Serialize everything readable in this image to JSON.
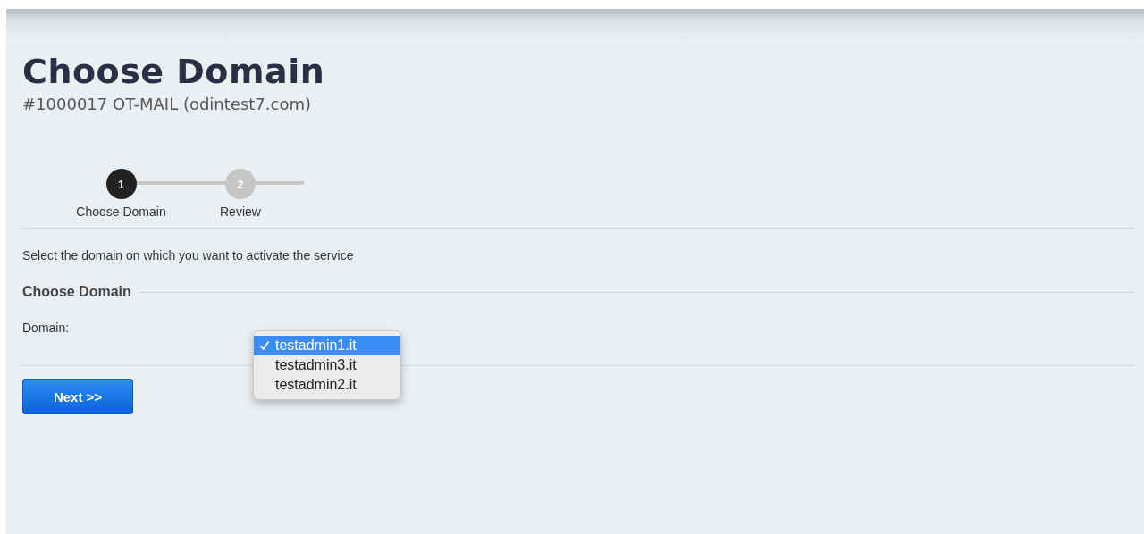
{
  "page": {
    "title": "Choose Domain",
    "subtitle": "#1000017 OT-MAIL (odintest7.com)"
  },
  "steps": [
    {
      "number": "1",
      "label": "Choose Domain",
      "current": true
    },
    {
      "number": "2",
      "label": "Review",
      "current": false
    }
  ],
  "instruction": "Select the domain on which you want to activate the service",
  "section": {
    "title": "Choose Domain"
  },
  "domain_field": {
    "label": "Domain:",
    "options": [
      {
        "label": "testadmin1.it",
        "selected": true
      },
      {
        "label": "testadmin3.it",
        "selected": false
      },
      {
        "label": "testadmin2.it",
        "selected": false
      }
    ]
  },
  "buttons": [
    {
      "label": "Next >>"
    }
  ]
}
